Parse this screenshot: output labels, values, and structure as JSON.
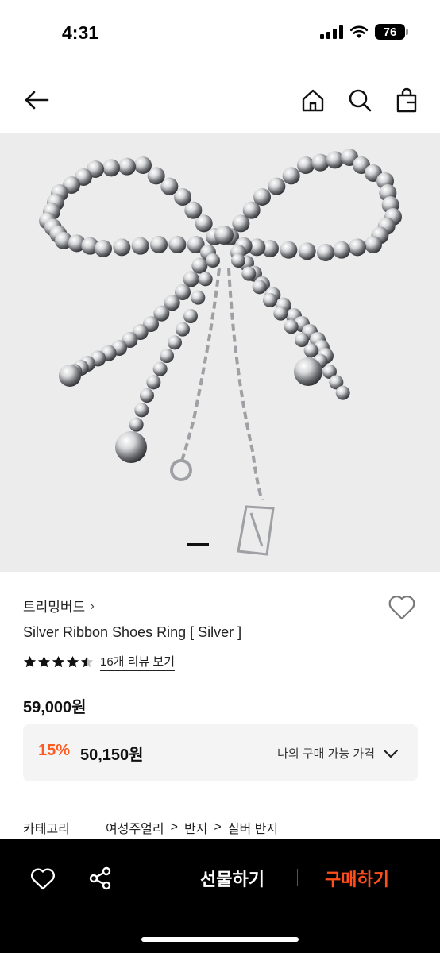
{
  "status_bar": {
    "time": "4:31",
    "battery": "76"
  },
  "nav": {
    "back_icon": "arrow-left-icon",
    "home_icon": "home-icon",
    "search_icon": "search-icon",
    "cart_icon": "shopping-bag-icon"
  },
  "gallery": {
    "current_index": 1,
    "total": 1
  },
  "product": {
    "brand": "트리밍버드",
    "brand_chevron": "›",
    "title": "Silver Ribbon Shoes Ring [ Silver ]",
    "rating": 4.5,
    "review_link": "16개 리뷰 보기",
    "price": "59,000원",
    "discount": {
      "rate": "15%",
      "price": "50,150원",
      "my_price_label": "나의 구매 가능 가격"
    },
    "category": {
      "label": "카테고리",
      "path": [
        "여성주얼리",
        "반지",
        "실버 반지"
      ],
      "separator": ">"
    }
  },
  "bottom_bar": {
    "gift_label": "선물하기",
    "buy_label": "구매하기",
    "accent_color": "#ff4e1a"
  },
  "colors": {
    "discount": "#ff5a1f",
    "hero_bg": "#ececed"
  }
}
